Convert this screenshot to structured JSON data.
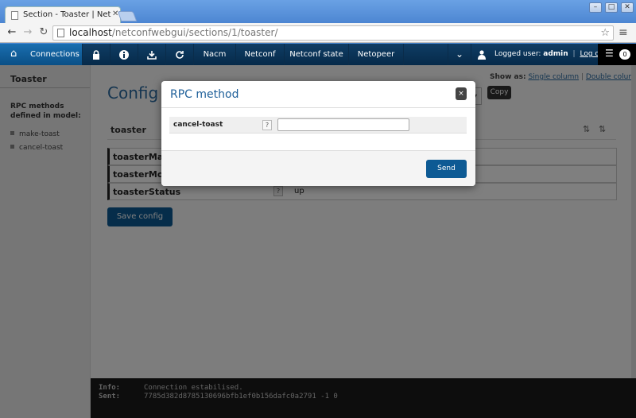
{
  "browser": {
    "tab_title": "Section - Toaster | Net",
    "url_host": "localhost",
    "url_path": "/netconfwebgui/sections/1/toaster/"
  },
  "nav": {
    "connections": "Connections",
    "items": [
      "Nacm",
      "Netconf",
      "Netconf state",
      "Netopeer"
    ],
    "logged_user_label": "Logged user:",
    "username": "admin",
    "logout": "Log out",
    "notifications_count": "0"
  },
  "sidebar": {
    "title": "Toaster",
    "rpc_heading": "RPC methods defined in model:",
    "rpc_items": [
      "make-toast",
      "cancel-toast"
    ]
  },
  "main": {
    "title": "Config &",
    "show_as_label": "Show as:",
    "single_column": "Single column",
    "double_column": "Double column",
    "copy": "Copy",
    "section_name": "toaster",
    "rows": [
      {
        "name": "toasterManu",
        "value": ""
      },
      {
        "name": "toasterMode",
        "value": ""
      },
      {
        "name": "toasterStatus",
        "value": "up"
      }
    ],
    "help": "?",
    "save": "Save config"
  },
  "console": {
    "info_label": "Info:",
    "info_value": "Connection estabilised.",
    "sent_label": "Sent:",
    "sent_value": "7785d382d8785130696bfb1ef0b156dafc0a2791 -1 0"
  },
  "modal": {
    "title": "RPC method",
    "close": "×",
    "field_label": "cancel-toast",
    "help": "?",
    "input_value": "",
    "send": "Send"
  },
  "colors": {
    "nav_bg": "#062a4a",
    "accent": "#0d5a94",
    "title_blue": "#2a6aa0"
  }
}
